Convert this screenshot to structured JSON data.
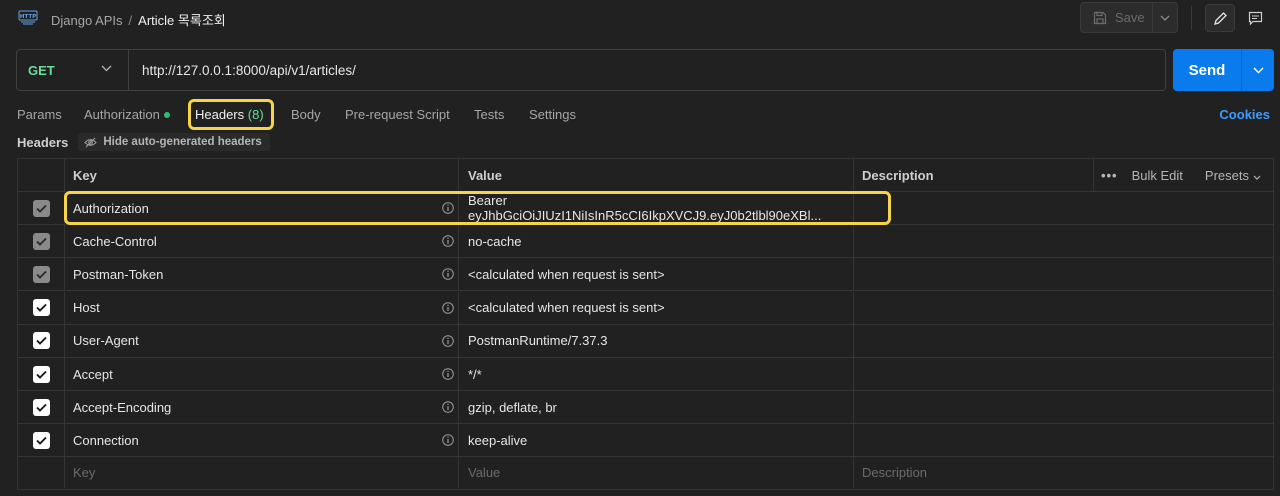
{
  "breadcrumb": {
    "collection": "Django APIs",
    "separator": "/",
    "request": "Article 목록조회"
  },
  "toolbar": {
    "save_label": "Save"
  },
  "request": {
    "method": "GET",
    "url": "http://127.0.0.1:8000/api/v1/articles/",
    "send_label": "Send"
  },
  "tabs": {
    "params": "Params",
    "authorization": "Authorization",
    "headers": "Headers",
    "headers_count": "(8)",
    "body": "Body",
    "prerequest": "Pre-request Script",
    "tests": "Tests",
    "settings": "Settings",
    "cookies": "Cookies"
  },
  "headers_section": {
    "title": "Headers",
    "hide_auto_label": "Hide auto-generated headers"
  },
  "table": {
    "columns": {
      "key": "Key",
      "value": "Value",
      "description": "Description"
    },
    "bulk_edit": "Bulk Edit",
    "presets": "Presets",
    "rows": [
      {
        "key": "Authorization",
        "value": "Bearer eyJhbGciOiJIUzI1NiIsInR5cCI6IkpXVCJ9.eyJ0b2tlbl90eXBl...",
        "checked": true,
        "auto": true
      },
      {
        "key": "Cache-Control",
        "value": "no-cache",
        "checked": true,
        "auto": true
      },
      {
        "key": "Postman-Token",
        "value": "<calculated when request is sent>",
        "checked": true,
        "auto": true
      },
      {
        "key": "Host",
        "value": "<calculated when request is sent>",
        "checked": true,
        "auto": false
      },
      {
        "key": "User-Agent",
        "value": "PostmanRuntime/7.37.3",
        "checked": true,
        "auto": false
      },
      {
        "key": "Accept",
        "value": "*/*",
        "checked": true,
        "auto": false
      },
      {
        "key": "Accept-Encoding",
        "value": "gzip, deflate, br",
        "checked": true,
        "auto": false
      },
      {
        "key": "Connection",
        "value": "keep-alive",
        "checked": true,
        "auto": false
      }
    ],
    "new_row": {
      "key": "Key",
      "value": "Value",
      "description": "Description"
    }
  },
  "colors": {
    "method": "#6bdd9a",
    "send": "#097bed",
    "highlight": "#f5d547",
    "cookies": "#3d9bff",
    "auth_dot": "#2ebd70"
  }
}
